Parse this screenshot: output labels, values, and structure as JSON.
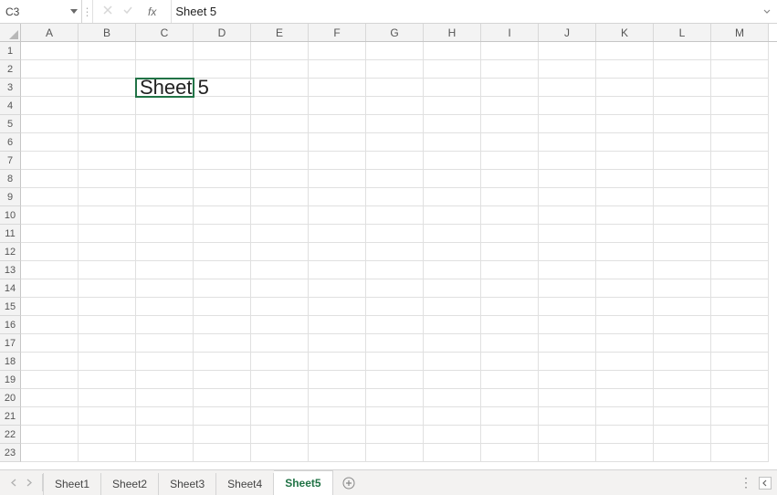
{
  "formula_bar": {
    "name_box_value": "C3",
    "cancel_icon": "✕",
    "enter_icon": "✓",
    "fx_label": "fx",
    "formula_value": "Sheet 5"
  },
  "grid": {
    "columns": [
      "A",
      "B",
      "C",
      "D",
      "E",
      "F",
      "G",
      "H",
      "I",
      "J",
      "K",
      "L",
      "M"
    ],
    "rows": [
      "1",
      "2",
      "3",
      "4",
      "5",
      "6",
      "7",
      "8",
      "9",
      "10",
      "11",
      "12",
      "13",
      "14",
      "15",
      "16",
      "17",
      "18",
      "19",
      "20",
      "21",
      "22",
      "23"
    ],
    "active_cell": "C3",
    "cells": {
      "C3": "Sheet 5"
    }
  },
  "tabs": {
    "items": [
      {
        "label": "Sheet1"
      },
      {
        "label": "Sheet2"
      },
      {
        "label": "Sheet3"
      },
      {
        "label": "Sheet4"
      },
      {
        "label": "Sheet5"
      }
    ],
    "active_index": 4
  }
}
